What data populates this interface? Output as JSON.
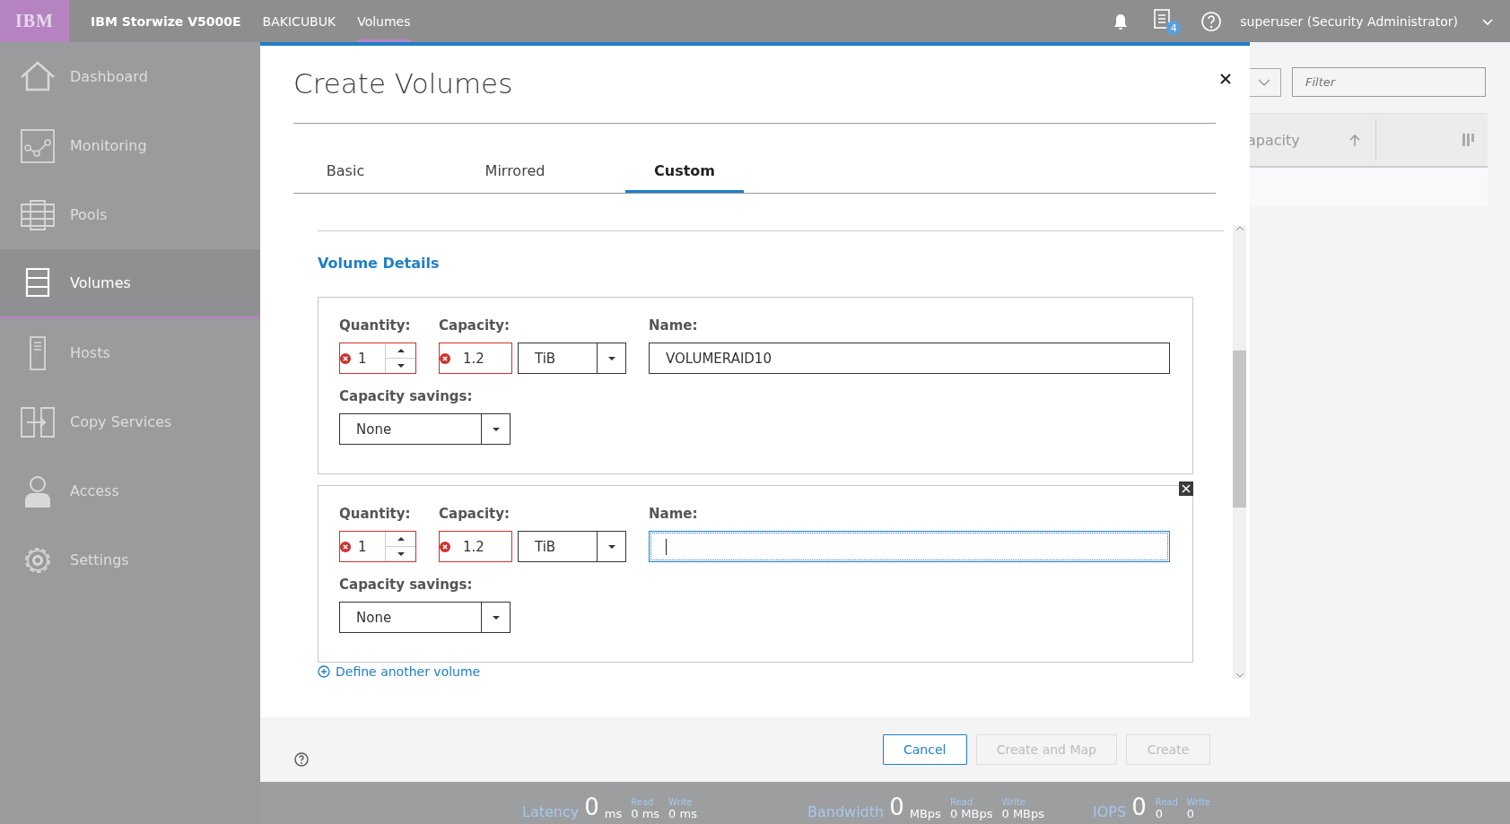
{
  "top_bar": {
    "logo": "IBM",
    "product": "IBM Storwize V5000E",
    "system": "BAKICUBUK",
    "page": "Volumes",
    "notification_count": "4",
    "user": "superuser (Security Administrator)"
  },
  "sidebar": {
    "items": [
      {
        "label": "Dashboard",
        "selected": false
      },
      {
        "label": "Monitoring",
        "selected": false
      },
      {
        "label": "Pools",
        "selected": false
      },
      {
        "label": "Volumes",
        "selected": true
      },
      {
        "label": "Hosts",
        "selected": false
      },
      {
        "label": "Copy Services",
        "selected": false
      },
      {
        "label": "Access",
        "selected": false
      },
      {
        "label": "Settings",
        "selected": false
      }
    ]
  },
  "background": {
    "filter_placeholder": "Filter",
    "column": "apacity"
  },
  "dialog": {
    "title": "Create Volumes",
    "tabs": [
      {
        "label": "Basic",
        "selected": false
      },
      {
        "label": "Mirrored",
        "selected": false
      },
      {
        "label": "Custom",
        "selected": true
      }
    ],
    "section": "Volume Details",
    "volumes": [
      {
        "quantity_label": "Quantity:",
        "quantity": "1",
        "quantity_error": true,
        "capacity_label": "Capacity:",
        "capacity": "1.2",
        "capacity_error": true,
        "unit": "TiB",
        "name_label": "Name:",
        "name": "VOLUMERAID10",
        "focused": false,
        "savings_label": "Capacity savings:",
        "savings": "None",
        "removable": false
      },
      {
        "quantity_label": "Quantity:",
        "quantity": "1",
        "quantity_error": true,
        "capacity_label": "Capacity:",
        "capacity": "1.2",
        "capacity_error": true,
        "unit": "TiB",
        "name_label": "Name:",
        "focused": true,
        "savings_label": "Capacity savings:",
        "savings": "None",
        "removable": true
      }
    ],
    "define_link": "Define another volume",
    "buttons": [
      {
        "label": "Cancel",
        "disabled": false
      },
      {
        "label": "Create and Map",
        "disabled": true
      },
      {
        "label": "Create",
        "disabled": true
      }
    ]
  },
  "status_bar": {
    "metrics": [
      {
        "label": "Latency",
        "value": "0",
        "unit": "ms",
        "read_label": "Read",
        "read": "0 ms",
        "write_label": "Write",
        "write": "0 ms"
      },
      {
        "label": "Bandwidth",
        "value": "0",
        "unit": "MBps",
        "read_label": "Read",
        "read": "0 MBps",
        "write_label": "Write",
        "write": "0 MBps"
      },
      {
        "label": "IOPS",
        "value": "0",
        "read_label": "Read",
        "read": "0",
        "write_label": "Write",
        "write": "0"
      }
    ]
  }
}
